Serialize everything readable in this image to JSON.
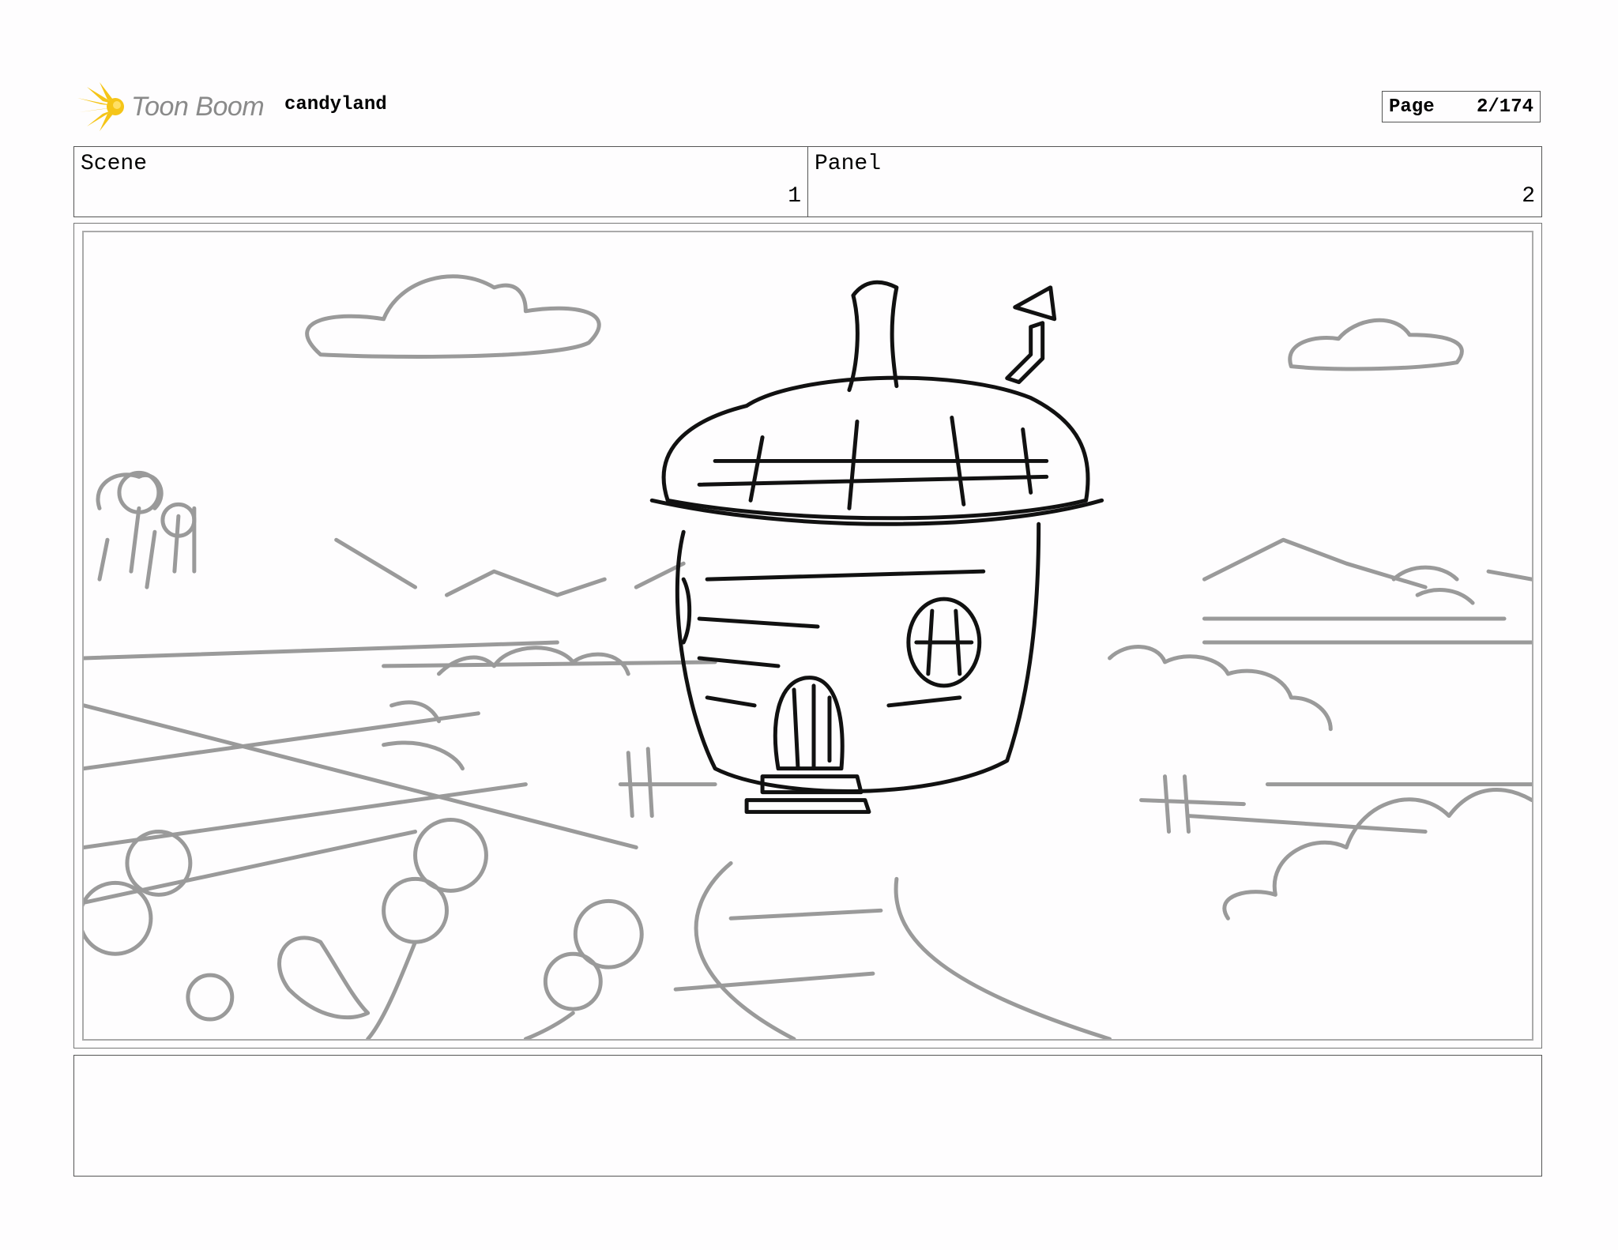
{
  "header": {
    "brand": "Toon Boom",
    "project_name": "candyland",
    "page_label": "Page",
    "page_value": "2/174"
  },
  "info": {
    "scene_label": "Scene",
    "scene_value": "1",
    "panel_label": "Panel",
    "panel_value": "2"
  },
  "panel": {
    "image_subject": "acorn-house-sketch"
  },
  "notes": {
    "text": ""
  },
  "colors": {
    "logo_yellow": "#f5c518",
    "logo_gray": "#8a8a8a",
    "sketch_black": "#111111",
    "sketch_gray": "#9a9a9a"
  }
}
